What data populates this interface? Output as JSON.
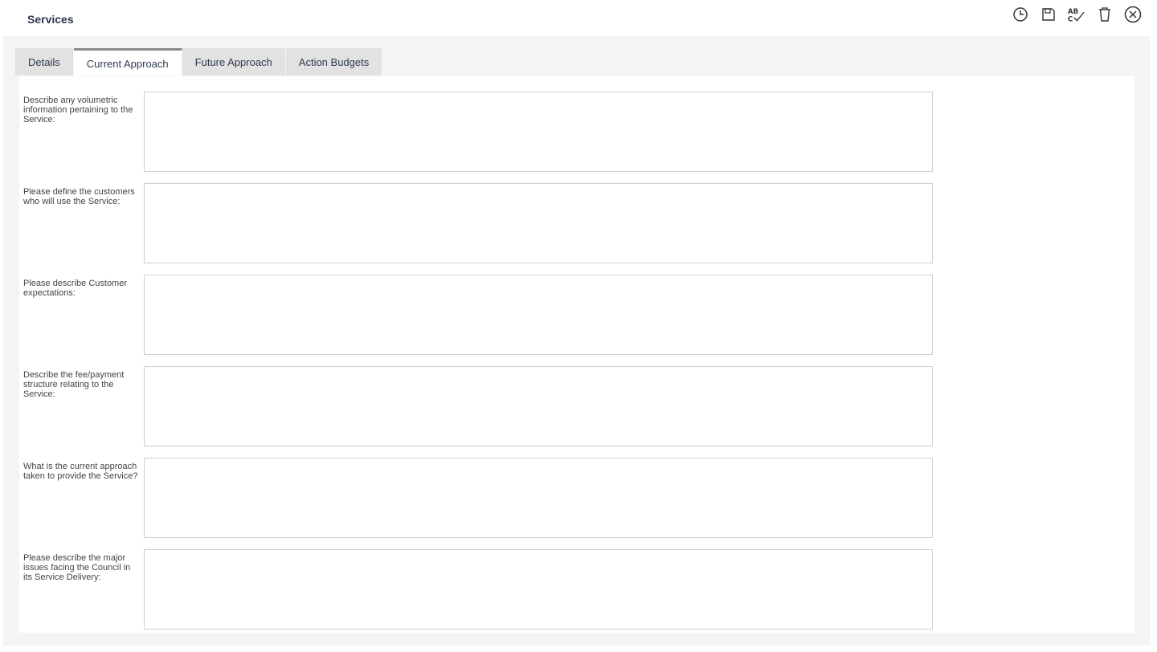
{
  "header": {
    "title": "Services",
    "tools": [
      {
        "icon": "history-icon",
        "label": ""
      },
      {
        "icon": "save-icon",
        "label": ""
      },
      {
        "icon": "spellcheck-icon",
        "label": "AB C"
      },
      {
        "icon": "delete-icon",
        "label": ""
      },
      {
        "icon": "close-icon",
        "label": ""
      }
    ]
  },
  "tabs": {
    "items": [
      {
        "label": "Details"
      },
      {
        "label": "Current Approach",
        "active": true
      },
      {
        "label": "Future Approach"
      },
      {
        "label": "Action Budgets"
      }
    ]
  },
  "form": {
    "fields": [
      {
        "label": "Describe any volumetric information pertaining to the Service:",
        "value": ""
      },
      {
        "label": "Please define the customers who will use the Service:",
        "value": ""
      },
      {
        "label": "Please describe Customer expectations:",
        "value": ""
      },
      {
        "label": "Describe the fee/payment structure relating to the Service:",
        "value": ""
      },
      {
        "label": "What is the current approach taken to provide the Service?",
        "value": ""
      },
      {
        "label": "Please describe the major issues facing the Council in its Service Delivery:",
        "value": ""
      }
    ]
  },
  "colors": {
    "title": "#2e3a4f",
    "panel_bg": "#f4f4f4",
    "tab_bg": "#e2e2e2",
    "active_tab_border": "#8a8a8a",
    "field_border": "#cfcfcf"
  }
}
